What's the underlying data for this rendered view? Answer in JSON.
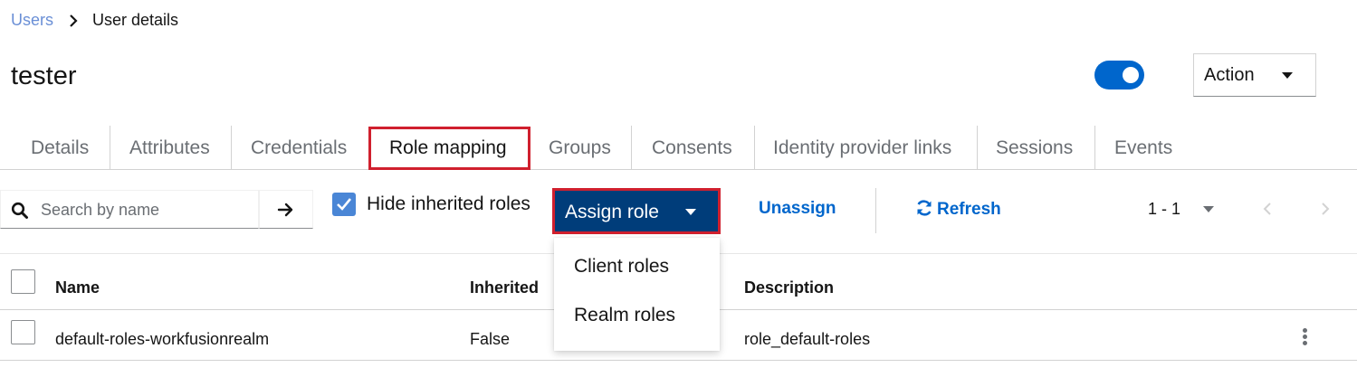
{
  "breadcrumb": {
    "link": "Users",
    "current": "User details"
  },
  "page_title": "tester",
  "header": {
    "enabled": true,
    "action_label": "Action"
  },
  "tabs": [
    {
      "label": "Details"
    },
    {
      "label": "Attributes"
    },
    {
      "label": "Credentials"
    },
    {
      "label": "Role mapping",
      "active": true
    },
    {
      "label": "Groups"
    },
    {
      "label": "Consents"
    },
    {
      "label": "Identity provider links"
    },
    {
      "label": "Sessions"
    },
    {
      "label": "Events"
    }
  ],
  "toolbar": {
    "search_placeholder": "Search by name",
    "search_value": "",
    "hide_inherited_label": "Hide inherited roles",
    "hide_inherited_checked": true,
    "assign_label": "Assign role",
    "unassign_label": "Unassign",
    "refresh_label": "Refresh",
    "pagination": "1 - 1"
  },
  "assign_menu": {
    "items": [
      {
        "label": "Client roles"
      },
      {
        "label": "Realm roles"
      }
    ]
  },
  "table": {
    "columns": [
      "Name",
      "Inherited",
      "Description"
    ],
    "rows": [
      {
        "name": "default-roles-workfusionrealm",
        "inherited": "False",
        "description": "role_default-roles"
      }
    ]
  },
  "colors": {
    "accent": "#0066cc",
    "primary_button": "#003d7a",
    "highlight": "#d0202e"
  },
  "icons": {
    "breadcrumb_separator": "chevron-right-icon",
    "search": "search-icon",
    "submit": "arrow-right-icon",
    "refresh": "sync-icon",
    "prev": "chevron-left-icon",
    "next": "chevron-right-icon",
    "row_actions": "kebab-icon"
  }
}
